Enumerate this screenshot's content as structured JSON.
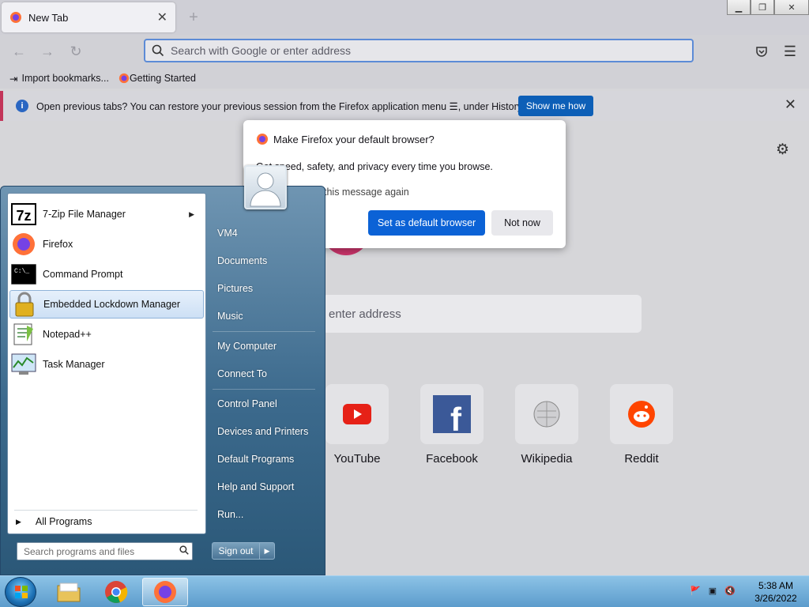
{
  "browser": {
    "tab_title": "New Tab",
    "url_placeholder": "Search with Google or enter address",
    "bookmarks": [
      "Import bookmarks...",
      "Getting Started"
    ],
    "infobar": {
      "message": "Open previous tabs? You can restore your previous session from the Firefox application menu ☰, under History.",
      "button": "Show me how"
    },
    "content_search_text": "enter address",
    "top_sites": [
      "YouTube",
      "Facebook",
      "Wikipedia",
      "Reddit"
    ]
  },
  "dialog": {
    "title": "Make Firefox your default browser?",
    "body": "Get speed, safety, and privacy every time you browse.",
    "checkbox_label": "this message again",
    "primary_button": "Set as default browser",
    "secondary_button": "Not now"
  },
  "start_menu": {
    "programs": [
      {
        "label": "7-Zip File Manager",
        "icon": "7zip-icon",
        "has_submenu": true
      },
      {
        "label": "Firefox",
        "icon": "firefox-icon"
      },
      {
        "label": "Command Prompt",
        "icon": "cmd-icon"
      },
      {
        "label": "Embedded Lockdown Manager",
        "icon": "lock-icon",
        "highlighted": true
      },
      {
        "label": "Notepad++",
        "icon": "notepad-icon"
      },
      {
        "label": "Task Manager",
        "icon": "task-manager-icon"
      }
    ],
    "all_programs": "All Programs",
    "search_placeholder": "Search programs and files",
    "right_links": [
      "VM4",
      "Documents",
      "Pictures",
      "Music",
      "My Computer",
      "Connect To",
      "Control Panel",
      "Devices and Printers",
      "Default Programs",
      "Help and Support",
      "Run..."
    ],
    "sign_out": "Sign out"
  },
  "taskbar": {
    "time": "5:38 AM",
    "date": "3/26/2022"
  },
  "colors": {
    "accent_blue": "#0b62d6",
    "infobar_accent": "#c3355a",
    "start_menu": "#3c6a8d"
  }
}
